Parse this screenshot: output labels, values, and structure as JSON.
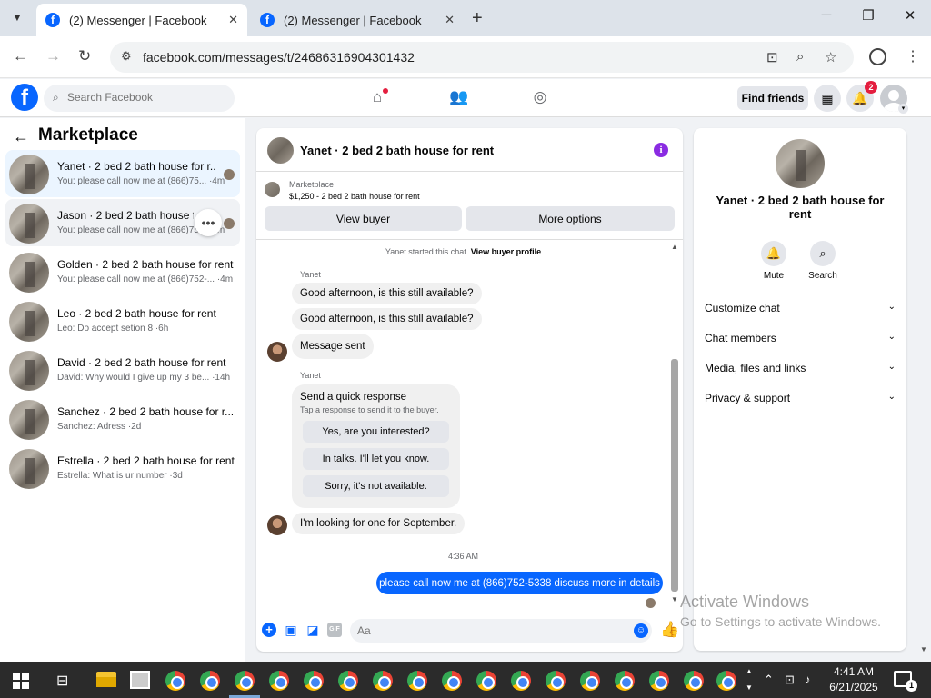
{
  "browser": {
    "tabs": [
      {
        "title": "(2) Messenger | Facebook",
        "active": true
      },
      {
        "title": "(2) Messenger | Facebook",
        "active": false
      }
    ],
    "url": "facebook.com/messages/t/24686316904301432"
  },
  "fb_header": {
    "search_placeholder": "Search Facebook",
    "find_friends": "Find friends",
    "notification_count": "2"
  },
  "sidebar": {
    "title": "Marketplace",
    "conversations": [
      {
        "name": "Yanet · 2 bed 2 bath house for r...",
        "snippet": "You: please call now me at (866)75... ·4m"
      },
      {
        "name": "Jason · 2 bed 2 bath house for r...",
        "snippet": "You: please call now me at (866)75... ·4m"
      },
      {
        "name": "Golden · 2 bed 2 bath house for rent",
        "snippet": "You: please call now me at (866)752-... ·4m"
      },
      {
        "name": "Leo · 2 bed 2 bath house for rent",
        "snippet": "Leo: Do accept setion 8 ·6h"
      },
      {
        "name": "David · 2 bed 2 bath house for rent",
        "snippet": "David: Why would I give up my 3 be... ·14h"
      },
      {
        "name": "Sanchez · 2 bed 2 bath house for r...",
        "snippet": "Sanchez: Adress ·2d"
      },
      {
        "name": "Estrella · 2 bed 2 bath house for rent",
        "snippet": "Estrella: What is ur number ·3d"
      }
    ]
  },
  "chat": {
    "title": "Yanet · 2 bed 2 bath house for rent",
    "listing": {
      "category": "Marketplace",
      "price_title": "$1,250 - 2 bed 2 bath house for rent",
      "view_buyer": "View buyer",
      "more_options": "More options"
    },
    "system_line": "Yanet started this chat.",
    "system_link": "View buyer profile",
    "sender_name": "Yanet",
    "messages": [
      "Good afternoon, is this still available?",
      "Good afternoon, is this still available?",
      "Message sent"
    ],
    "sender_name_2": "Yanet",
    "quick_response": {
      "title": "Send a quick response",
      "subtitle": "Tap a response to send it to the buyer.",
      "options": [
        "Yes, are you interested?",
        "In talks. I'll let you know.",
        "Sorry, it's not available."
      ]
    },
    "last_incoming": "I'm looking for one for September.",
    "timestamp": "4:36 AM",
    "outgoing": "please call now me at (866)752-5338 discuss more in details",
    "composer_placeholder": "Aa"
  },
  "info_panel": {
    "name": "Yanet · 2 bed 2 bath house for rent",
    "actions": [
      {
        "label": "Mute",
        "icon": "bell-icon"
      },
      {
        "label": "Search",
        "icon": "search-icon"
      }
    ],
    "sections": [
      "Customize chat",
      "Chat members",
      "Media, files and links",
      "Privacy & support"
    ]
  },
  "watermark": {
    "line1": "Activate Windows",
    "line2": "Go to Settings to activate Windows."
  },
  "taskbar": {
    "time": "4:41 AM",
    "date": "6/21/2025",
    "notification_count": "1"
  },
  "colors": {
    "fb_blue": "#0866ff",
    "badge_red": "#e41e3f",
    "info_purple": "#8a2be2"
  }
}
